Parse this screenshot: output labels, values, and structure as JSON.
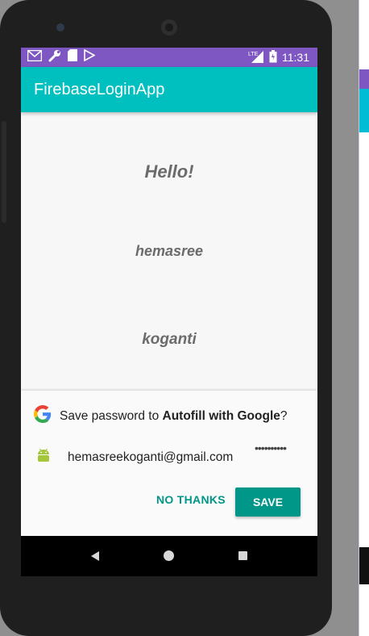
{
  "status_bar": {
    "time": "11:31",
    "network": "LTE",
    "icons": [
      "gmail-icon",
      "wrench-icon",
      "sd-card-icon",
      "play-store-icon",
      "signal-icon",
      "battery-icon"
    ],
    "color": "#7e57c2"
  },
  "app_bar": {
    "title": "FirebaseLoginApp",
    "color": "#00bfbf"
  },
  "main": {
    "greeting": "Hello!",
    "first_name": "hemasree",
    "last_name": "koganti"
  },
  "autofill_dialog": {
    "title_prefix": "Save password to ",
    "title_service": "Autofill with Google",
    "title_suffix": "?",
    "email": "hemasreekoganti@gmail.com",
    "masked_password": "••••••••••",
    "no_thanks_label": "NO THANKS",
    "save_label": "SAVE",
    "accent_color": "#009688"
  },
  "nav_bar": {
    "buttons": [
      "back-icon",
      "home-icon",
      "recents-icon"
    ]
  }
}
